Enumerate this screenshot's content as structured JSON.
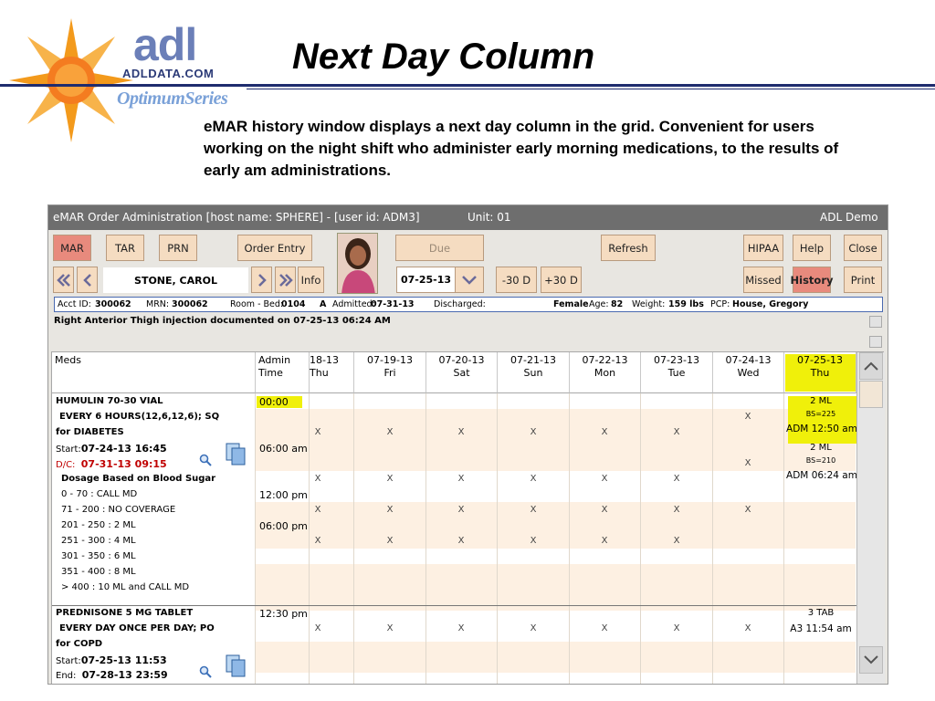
{
  "slide": {
    "logo_brand": "adl",
    "logo_url": "ADLDATA.COM",
    "logo_series": "OptimumSeries",
    "title": "Next Day Column",
    "body": "eMAR history window displays a next day column in the grid. Convenient for users working on the night shift who administer early morning medications, to the results of early am administrations."
  },
  "window": {
    "title": "eMAR Order Administration [host name: SPHERE] - [user id: ADM3]",
    "unit": "Unit: 01",
    "company": "ADL Demo"
  },
  "toolbar": {
    "mar": "MAR",
    "tar": "TAR",
    "prn": "PRN",
    "order_entry": "Order Entry",
    "due": "Due",
    "refresh": "Refresh",
    "hipaa": "HIPAA",
    "help": "Help",
    "close": "Close",
    "patient": "STONE, CAROL",
    "info": "Info",
    "date": "07-25-13",
    "minus30": "-30 D",
    "plus30": "+30 D",
    "missed": "Missed",
    "history": "History",
    "print": "Print"
  },
  "patient_info": {
    "acct_label": "Acct ID:",
    "acct": "300062",
    "mrn_label": "MRN:",
    "mrn": "300062",
    "room_label": "Room - Bed:",
    "room": "0104",
    "bed": "A",
    "admitted_label": "Admitted:",
    "admitted": "07-31-13",
    "discharged_label": "Discharged:",
    "sex": "Female",
    "age_label": "Age:",
    "age": "82",
    "weight_label": "Weight:",
    "weight": "159 lbs",
    "pcp_label": "PCP:",
    "pcp": "House, Gregory"
  },
  "note": "Right Anterior Thigh injection documented on 07-25-13 06:24 AM",
  "grid": {
    "meds_header": "Meds",
    "admin_header_1": "Admin",
    "admin_header_2": "Time",
    "days": [
      {
        "date": "18-13",
        "day": "Thu"
      },
      {
        "date": "07-19-13",
        "day": "Fri"
      },
      {
        "date": "07-20-13",
        "day": "Sat"
      },
      {
        "date": "07-21-13",
        "day": "Sun"
      },
      {
        "date": "07-22-13",
        "day": "Mon"
      },
      {
        "date": "07-23-13",
        "day": "Tue"
      },
      {
        "date": "07-24-13",
        "day": "Wed"
      },
      {
        "date": "07-25-13",
        "day": "Thu"
      }
    ],
    "med1": {
      "name": "HUMULIN 70-30 VIAL",
      "sig": "EVERY 6 HOURS(12,6,12,6); SQ",
      "for": "for  DIABETES",
      "start_label": "Start:",
      "start": "07-24-13 16:45",
      "dc_label": "D/C:",
      "dc": "07-31-13 09:15",
      "dosage_title": "Dosage Based on Blood Sugar",
      "scale": [
        "0 - 70 : CALL MD",
        "71 - 200 : NO COVERAGE",
        "201 - 250 : 2 ML",
        "251 - 300 : 4 ML",
        "301 - 350 : 6 ML",
        "351 - 400 : 8 ML",
        "> 400 : 10 ML and CALL MD"
      ],
      "times": [
        "00:00",
        "06:00 am",
        "12:00 pm",
        "06:00 pm"
      ],
      "admin1_dose": "2 ML",
      "admin1_bs": "BS=225",
      "admin1_by": "ADM 12:50 am",
      "admin2_dose": "2 ML",
      "admin2_bs": "BS=210",
      "admin2_by": "ADM 06:24 am"
    },
    "med2": {
      "name": "PREDNISONE 5 MG TABLET",
      "sig": "EVERY DAY ONCE PER DAY; PO",
      "for": "for  COPD",
      "start_label": "Start:",
      "start": "07-25-13 11:53",
      "end_label": "End:",
      "end": "07-28-13 23:59",
      "time": "12:30 pm",
      "admin_dose": "3 TAB",
      "admin_by": "A3 11:54 am"
    },
    "x_mark": "X"
  },
  "colors": {
    "peach_button": "#f5dcc1",
    "active_button": "#e88a7d",
    "highlight": "#f0f00a",
    "title_bar": "#6e6e6e"
  },
  "icons": [
    "sun-logo",
    "first-page-icon",
    "prev-icon",
    "next-icon",
    "last-page-icon",
    "dropdown-chevron-icon",
    "magnifier-icon",
    "notes-icon",
    "scroll-up-icon",
    "scroll-down-icon"
  ]
}
